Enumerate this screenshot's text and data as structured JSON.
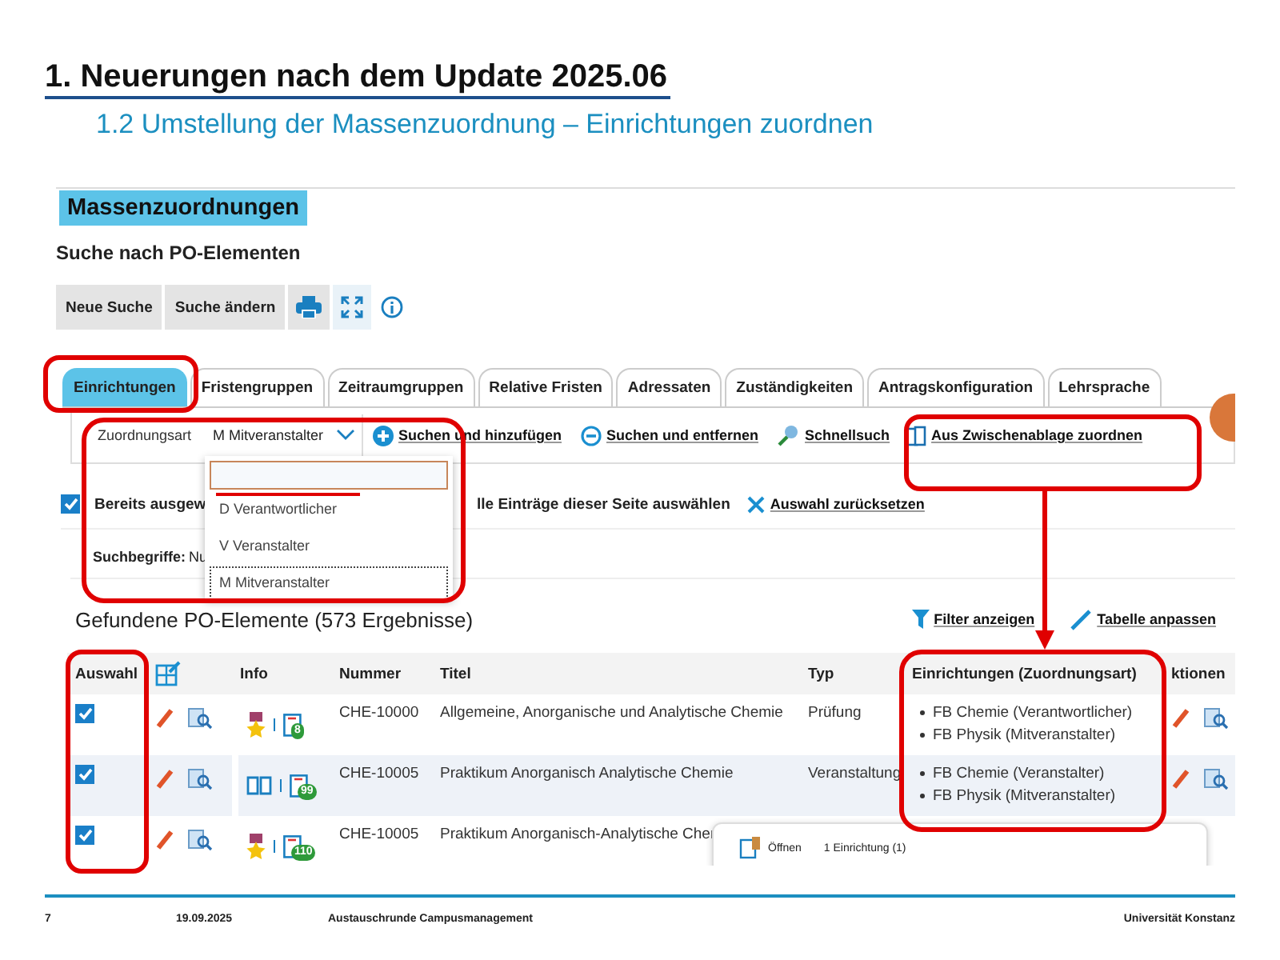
{
  "slide": {
    "title": "1. Neuerungen nach dem Update 2025.06",
    "subtitle": "1.2 Umstellung der Massenzuordnung – Einrichtungen zuordnen"
  },
  "app": {
    "heading": "Massenzuordnungen",
    "section": "Suche nach PO-Elementen",
    "toolbar": {
      "buttons": [
        "Neue Suche",
        "Suche ändern"
      ]
    },
    "tabs": [
      {
        "label": "Einrichtungen",
        "selected": true
      },
      {
        "label": "Fristengruppen",
        "selected": false
      },
      {
        "label": "Zeitraumgruppen",
        "selected": false
      },
      {
        "label": "Relative Fristen",
        "selected": false
      },
      {
        "label": "Adressaten",
        "selected": false
      },
      {
        "label": "Zuständigkeiten",
        "selected": false
      },
      {
        "label": "Antragskonfiguration",
        "selected": false
      },
      {
        "label": "Lehrsprache",
        "selected": false
      }
    ],
    "assignment": {
      "label": "Zuordnungsart",
      "value": "M Mitveranstalter"
    },
    "actions": [
      {
        "kind": "add",
        "label": "Suchen und hinzufügen"
      },
      {
        "kind": "remove",
        "label": "Suchen und entfernen"
      },
      {
        "kind": "search",
        "label": "Schnellsuch"
      },
      {
        "kind": "clipboard",
        "label": "Aus Zwischenablage zuordnen"
      }
    ],
    "selection_bar": {
      "checked": true,
      "label": "Bereits ausgew",
      "select_all": "lle Einträge dieser Seite auswählen",
      "reset": "Auswahl zurücksetzen"
    },
    "search_terms": {
      "label": "Suchbegriffe:",
      "value": "Nu"
    },
    "dropdown": {
      "options": [
        {
          "label": "D Verantwortlicher",
          "selected": false
        },
        {
          "label": "V Veranstalter",
          "selected": false
        },
        {
          "label": "M Mitveranstalter",
          "selected": true
        }
      ]
    },
    "results_title": "Gefundene PO-Elemente (573 Ergebnisse)",
    "result_links": [
      {
        "kind": "filter",
        "label": "Filter anzeigen"
      },
      {
        "kind": "customize",
        "label": "Tabelle anpassen"
      }
    ],
    "table": {
      "columns": [
        {
          "kind": "text",
          "label": "Auswahl"
        },
        {
          "kind": "icon"
        },
        {
          "kind": "text",
          "label": "Info"
        },
        {
          "kind": "text",
          "label": "Nummer"
        },
        {
          "kind": "text",
          "label": "Titel"
        },
        {
          "kind": "text",
          "label": "Typ"
        },
        {
          "kind": "text",
          "label": "Einrichtungen (Zuordnungsart)"
        },
        {
          "kind": "text",
          "label": "ktionen"
        }
      ],
      "rows": [
        {
          "checked": true,
          "kind": "award",
          "badge": "8",
          "number": "CHE-10000",
          "title": "Allgemeine, Anorganische und Analytische Chemie",
          "type": "Prüfung",
          "institutions": [
            "FB Chemie (Verantwortlicher)",
            "FB Physik (Mitveranstalter)"
          ]
        },
        {
          "checked": true,
          "kind": "book",
          "badge": "99",
          "number": "CHE-10005",
          "title": "Praktikum Anorganisch  Analytische Chemie",
          "type": "Veranstaltung",
          "institutions": [
            "FB Chemie (Veranstalter)",
            "FB Physik (Mitveranstalter)"
          ]
        },
        {
          "checked": true,
          "kind": "award",
          "badge": "110",
          "number": "CHE-10005",
          "title": "Praktikum Anorganisch-Analytische Cher"
        }
      ]
    },
    "popup": {
      "action": "Öffnen",
      "text": "1 Einrichtung (1)"
    }
  },
  "footer": {
    "page": "7",
    "date": "19.09.2025",
    "event": "Austauschrunde Campusmanagement",
    "org": "Universität Konstanz"
  }
}
